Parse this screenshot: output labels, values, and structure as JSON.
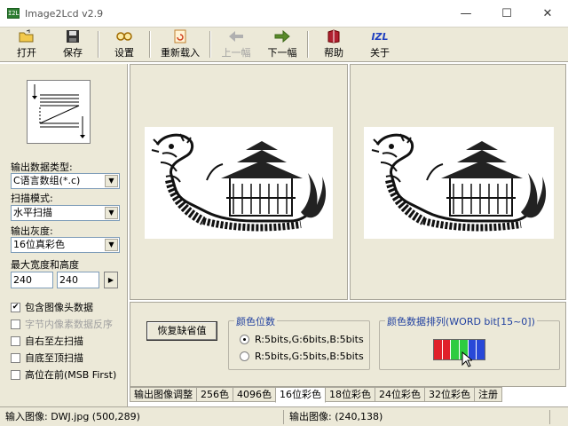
{
  "window": {
    "app_icon_text": "I2L",
    "title": "Image2Lcd v2.9",
    "controls": {
      "minimize": "—",
      "maximize": "☐",
      "close": "✕"
    }
  },
  "toolbar": {
    "open": "打开",
    "save": "保存",
    "settings": "设置",
    "reload": "重新载入",
    "prev": "上一幅",
    "next": "下一幅",
    "help": "帮助",
    "about": "关于",
    "about_icon_text": "IZL"
  },
  "left": {
    "output_type_label": "输出数据类型:",
    "output_type_value": "C语言数组(*.c)",
    "scan_mode_label": "扫描模式:",
    "scan_mode_value": "水平扫描",
    "gray_label": "输出灰度:",
    "gray_value": "16位真彩色",
    "size_label": "最大宽度和高度",
    "max_width": "240",
    "max_height": "240",
    "spin_glyph": "▶",
    "combo_arrow": "▼",
    "checkboxes": [
      {
        "label": "包含图像头数据",
        "checked": true,
        "enabled": true
      },
      {
        "label": "字节内像素数据反序",
        "checked": false,
        "enabled": false
      },
      {
        "label": "自右至左扫描",
        "checked": false,
        "enabled": true
      },
      {
        "label": "自底至顶扫描",
        "checked": false,
        "enabled": true
      },
      {
        "label": "高位在前(MSB First)",
        "checked": false,
        "enabled": true
      }
    ],
    "check_mark": "✔"
  },
  "bottom": {
    "restore_button": "恢复缺省值",
    "color_bits_title": "颜色位数",
    "radio_1": "R:5bits,G:6bits,B:5bits",
    "radio_2": "R:5bits,G:5bits,B:5bits",
    "arrangement_title": "颜色数据排列(WORD bit[15~0])",
    "colors": {
      "red": "#e0202a",
      "green": "#2ecc40",
      "blue": "#2848d8"
    }
  },
  "tabs": [
    "输出图像调整",
    "256色",
    "4096色",
    "16位彩色",
    "18位彩色",
    "24位彩色",
    "32位彩色",
    "注册"
  ],
  "active_tab": "16位彩色",
  "status": {
    "input": "输入图像: DWJ.jpg (500,289)",
    "output": "输出图像: (240,138)"
  }
}
